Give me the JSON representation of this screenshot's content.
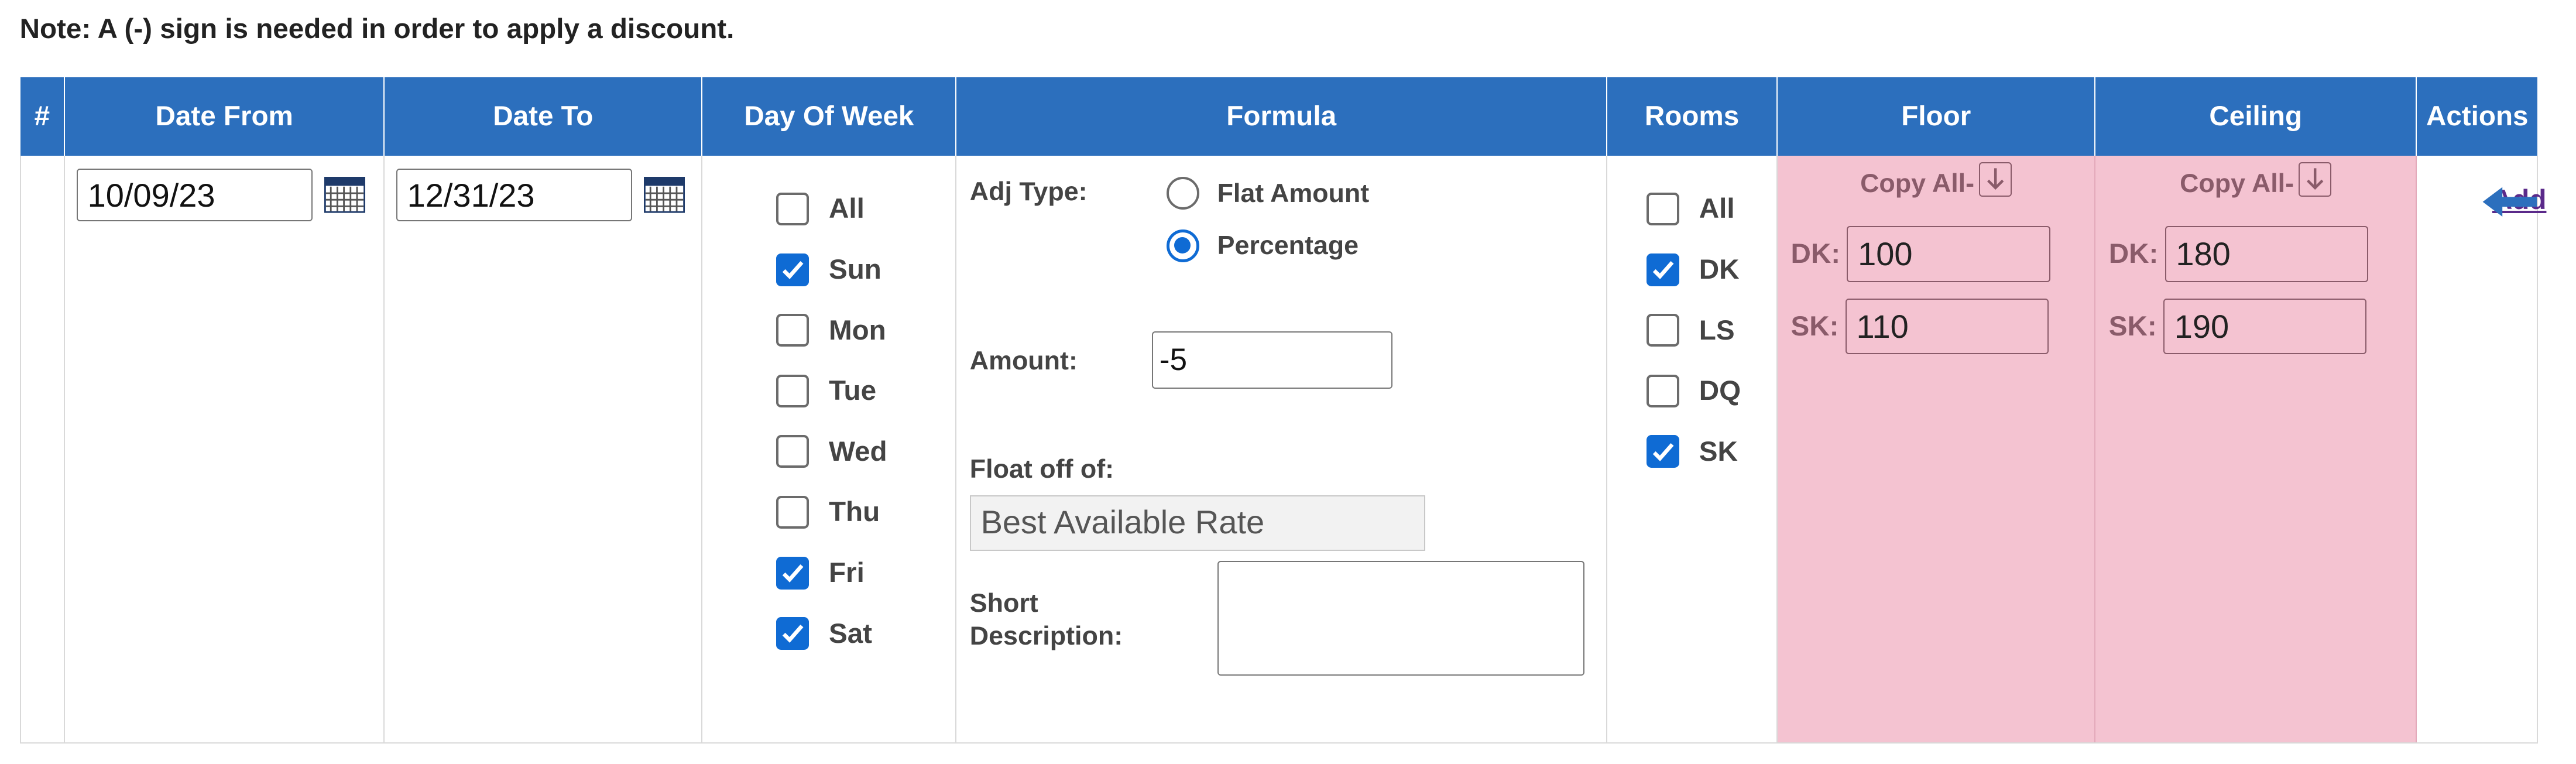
{
  "note": "Note: A (-) sign is needed in order to apply a discount.",
  "columns": [
    "#",
    "Date From",
    "Date To",
    "Day Of Week",
    "Formula",
    "Rooms",
    "Floor",
    "Ceiling",
    "Actions"
  ],
  "row": {
    "date_from": "10/09/23",
    "date_to": "12/31/23",
    "days": [
      {
        "label": "All",
        "checked": false
      },
      {
        "label": "Sun",
        "checked": true
      },
      {
        "label": "Mon",
        "checked": false
      },
      {
        "label": "Tue",
        "checked": false
      },
      {
        "label": "Wed",
        "checked": false
      },
      {
        "label": "Thu",
        "checked": false
      },
      {
        "label": "Fri",
        "checked": true
      },
      {
        "label": "Sat",
        "checked": true
      }
    ],
    "formula": {
      "adj_type_label": "Adj Type:",
      "adj_options": [
        {
          "label": "Flat Amount",
          "selected": false
        },
        {
          "label": "Percentage",
          "selected": true
        }
      ],
      "amount_label": "Amount:",
      "amount_value": "-5",
      "float_label": "Float off of:",
      "float_value": "Best Available Rate",
      "short_desc_label_1": "Short",
      "short_desc_label_2": "Description:",
      "short_desc_value": ""
    },
    "rooms": [
      {
        "label": "All",
        "checked": false
      },
      {
        "label": "DK",
        "checked": true
      },
      {
        "label": "LS",
        "checked": false
      },
      {
        "label": "DQ",
        "checked": false
      },
      {
        "label": "SK",
        "checked": true
      }
    ],
    "floor": {
      "copy_all": "Copy All-",
      "rates": [
        {
          "label": "DK:",
          "value": "100"
        },
        {
          "label": "SK:",
          "value": "110"
        }
      ]
    },
    "ceiling": {
      "copy_all": "Copy All-",
      "rates": [
        {
          "label": "DK:",
          "value": "180"
        },
        {
          "label": "SK:",
          "value": "190"
        }
      ]
    },
    "action": "Add"
  },
  "colors": {
    "header_bg": "#2c6fbd",
    "rate_bg": "#f4c3d1",
    "checkbox_on": "#0f6bd4",
    "arrow": "#2c6fbd"
  },
  "icons": [
    "calendar-icon",
    "checkmark-icon",
    "copy-down-icon",
    "arrow-left-icon",
    "resize-grip-icon"
  ]
}
